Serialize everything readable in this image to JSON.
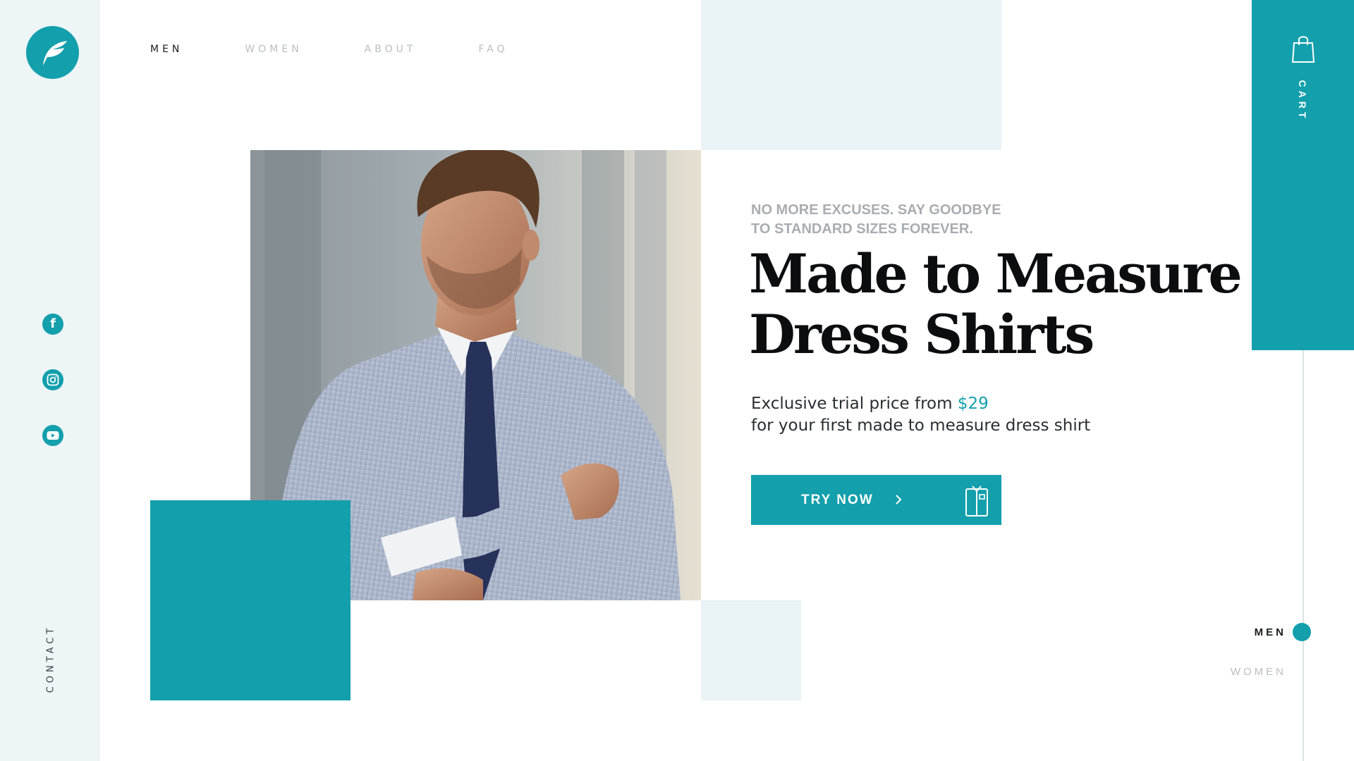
{
  "colors": {
    "accent": "#139fac",
    "panel": "#edf5f6",
    "heading": "#0c0d0e",
    "muted": "#a9adb1",
    "nav_inactive": "#b9bec3"
  },
  "brand": {
    "logo_icon": "feather-leaf-icon"
  },
  "nav": {
    "items": [
      {
        "label": "MEN",
        "active": true
      },
      {
        "label": "WOMEN",
        "active": false
      },
      {
        "label": "ABOUT",
        "active": false
      },
      {
        "label": "FAQ",
        "active": false
      }
    ]
  },
  "social": {
    "items": [
      {
        "icon": "facebook-icon"
      },
      {
        "icon": "instagram-icon"
      },
      {
        "icon": "youtube-icon"
      }
    ]
  },
  "contact_label": "CONTACT",
  "hero": {
    "tagline_line1": "NO MORE EXCUSES. SAY GOODBYE",
    "tagline_line2": "TO STANDARD SIZES FOREVER.",
    "headline_line1": "Made to Measure",
    "headline_line2": "Dress Shirts",
    "subtext_prefix": "Exclusive trial price from ",
    "price": "$29",
    "subtext_line2": "for your first made to measure dress shirt",
    "cta_label": "TRY NOW",
    "cta_icon": "shirt-icon",
    "image": "man-in-dress-shirt-and-tie-photo"
  },
  "cart": {
    "label": "CART",
    "icon": "shopping-bag-icon"
  },
  "section_nav": {
    "items": [
      {
        "label": "MEN",
        "active": true
      },
      {
        "label": "WOMEN",
        "active": false
      }
    ]
  }
}
